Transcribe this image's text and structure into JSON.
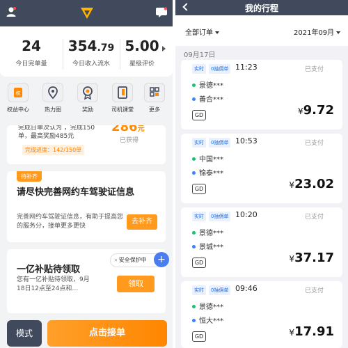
{
  "left": {
    "stats": [
      {
        "int": "24",
        "dec": "",
        "label": "今日完单量"
      },
      {
        "int": "354",
        "dec": ".79",
        "label": "今日收入流水"
      },
      {
        "int": "5.00",
        "dec": "",
        "label": "星级评价"
      }
    ],
    "quick_actions": [
      {
        "label": "权益中心",
        "icon": "benefits-icon"
      },
      {
        "label": "热力图",
        "icon": "map-pin-icon"
      },
      {
        "label": "奖励",
        "icon": "medal-icon"
      },
      {
        "label": "司机课堂",
        "icon": "class-icon"
      },
      {
        "label": "更多",
        "icon": "grid-icon"
      }
    ],
    "reward_card": {
      "line1": "完成日单次认为 ，完成150",
      "line2": "单，最高奖励485元",
      "amount": "286",
      "amount_unit": "元",
      "earned": "已获得",
      "progress": "完成进度：142/150单"
    },
    "license_card": {
      "tag": "待补齐",
      "title": "请尽快完善网约车驾驶证信息",
      "desc": "完善网约车驾驶证信息，有助于提高您的服务分，接单更多更快",
      "button": "去补齐"
    },
    "subsidy_card": {
      "title": "一亿补贴待领取",
      "desc": "您有一亿补贴待领取，9月18日12点至24点和…",
      "button": "领取"
    },
    "safety": {
      "label": "安全保护中",
      "plus": "+"
    },
    "bottom": {
      "mode": "模式",
      "go": "点击接单"
    }
  },
  "right": {
    "title": "我的行程",
    "filter_all": "全部订单",
    "filter_month": "2021年09月",
    "date": "09月17日",
    "trips": [
      {
        "type": "实时",
        "tag": "0抽佣单",
        "time": "11:23",
        "status": "已支付",
        "from": "景德***",
        "to": "善合***",
        "gd": "GD",
        "currency": "¥",
        "price": "9.72"
      },
      {
        "type": "实时",
        "tag": "0抽佣单",
        "time": "10:53",
        "status": "已支付",
        "from": "中国***",
        "to": "锦泰***",
        "gd": "GD",
        "currency": "¥",
        "price": "23.02"
      },
      {
        "type": "实时",
        "tag": "0抽佣单",
        "time": "10:20",
        "status": "已支付",
        "from": "景德***",
        "to": "景城***",
        "gd": "GD",
        "currency": "¥",
        "price": "37.17"
      },
      {
        "type": "实时",
        "tag": "0抽佣单",
        "time": "09:46",
        "status": "已支付",
        "from": "景德***",
        "to": "恒大***",
        "gd": "GD",
        "currency": "¥",
        "price": "17.91"
      }
    ],
    "colors": {
      "from_dot": "#1fbf6f",
      "to_dot": "#3b82f6"
    }
  }
}
